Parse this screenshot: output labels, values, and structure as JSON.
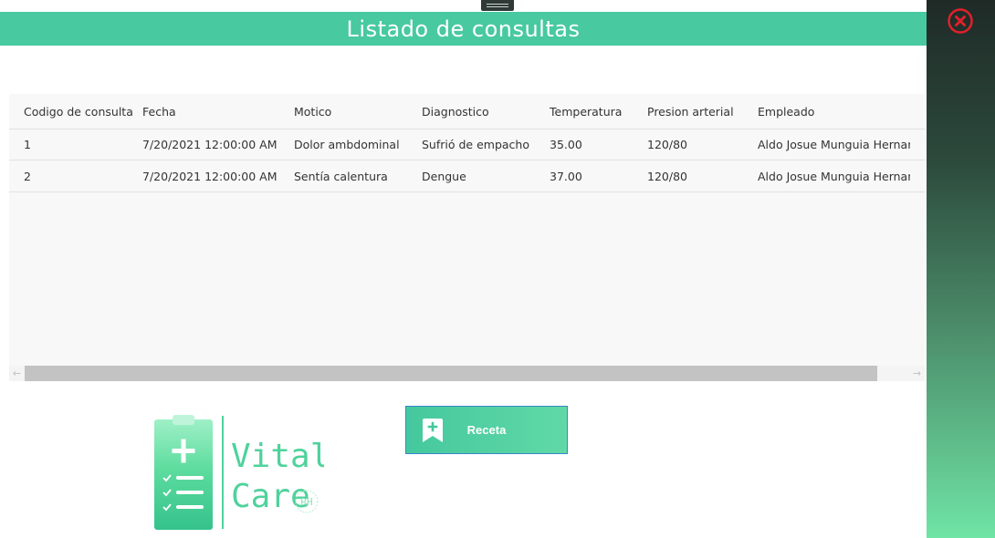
{
  "window": {
    "title": "Listado de consultas"
  },
  "table": {
    "columns": [
      "Codigo de consulta",
      "Fecha",
      "Motico",
      "Diagnostico",
      "Temperatura",
      "Presion arterial",
      "Empleado"
    ],
    "rows": [
      [
        "1",
        "7/20/2021 12:00:00 AM",
        "Dolor ambdominal",
        "Sufrió de empacho",
        "35.00",
        "120/80",
        "Aldo Josue Munguia Hernandez"
      ],
      [
        "2",
        "7/20/2021 12:00:00 AM",
        "Sentía calentura",
        "Dengue",
        "37.00",
        "120/80",
        "Aldo Josue Munguia Hernandez"
      ]
    ]
  },
  "scrollbar": {
    "left_arrow": "←",
    "right_arrow": "→"
  },
  "actions": {
    "receta_label": "Receta"
  },
  "logo": {
    "line1": "Vital",
    "line2": "Care",
    "badge": "RH"
  },
  "icons": {
    "close": "close-icon",
    "receta": "bookmark-plus-icon",
    "logo": "clipboard-icon"
  },
  "colors": {
    "accent": "#48c9a0",
    "close": "#e0202a"
  }
}
